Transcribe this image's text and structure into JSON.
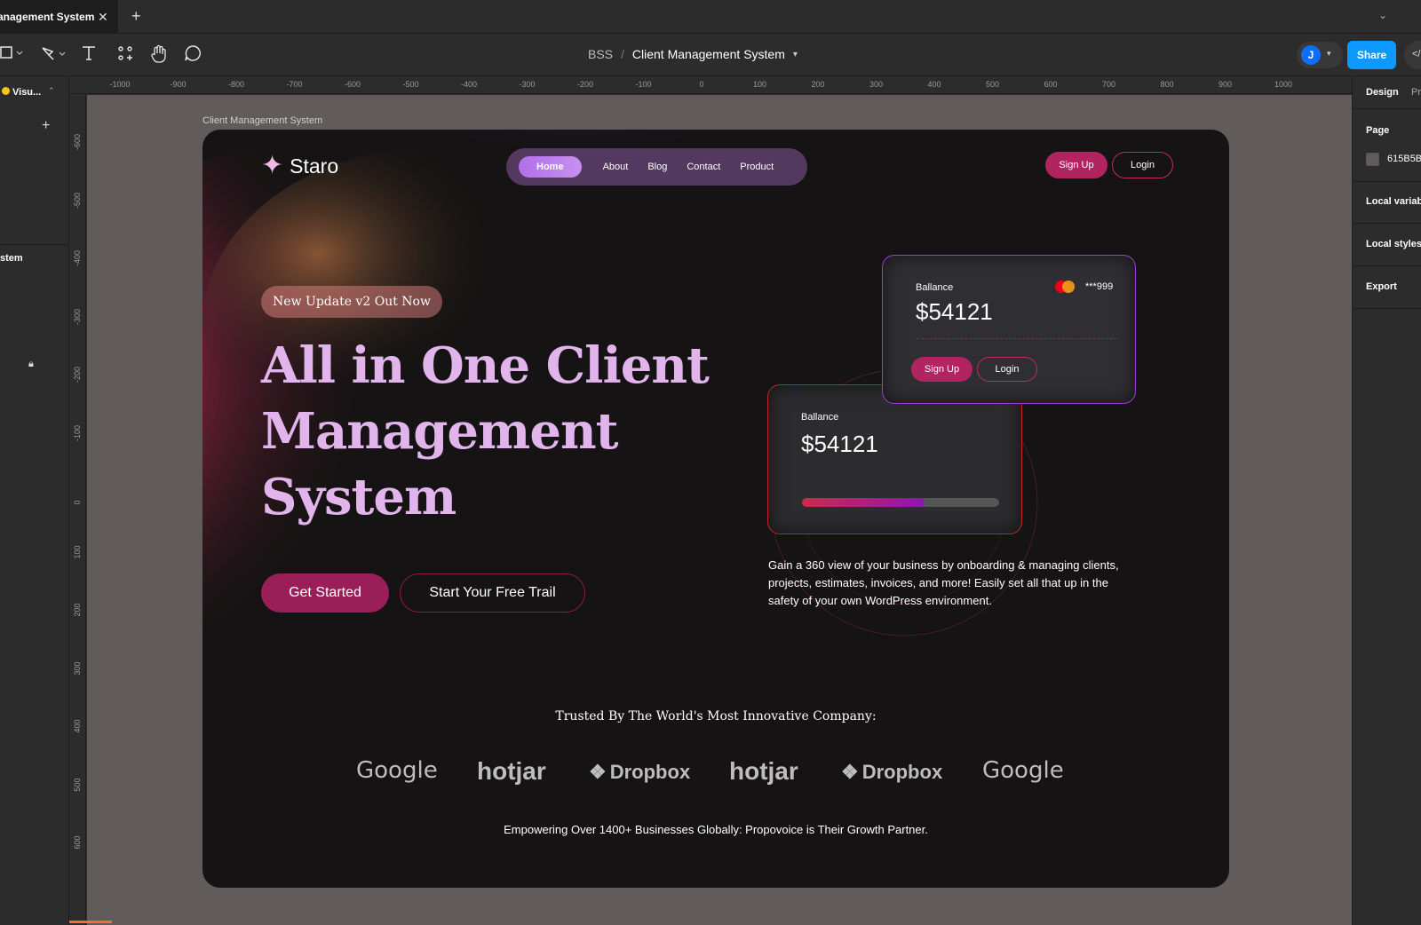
{
  "app": {
    "tab_title": "anagement System",
    "project": "BSS",
    "file_name": "Client Management System",
    "user_initial": "J",
    "share_label": "Share",
    "code_label": "</"
  },
  "left_panel": {
    "page_name": "Visu...",
    "layer_name": "stem"
  },
  "rulers": {
    "top": [
      "-1000",
      "-900",
      "-800",
      "-700",
      "-600",
      "-500",
      "-400",
      "-300",
      "-200",
      "-100",
      "0",
      "100",
      "200",
      "300",
      "400",
      "500",
      "600",
      "700",
      "800",
      "900",
      "1000"
    ],
    "left": [
      "-600",
      "-500",
      "-400",
      "-300",
      "-200",
      "-100",
      "0",
      "100",
      "200",
      "300",
      "400",
      "500",
      "600"
    ]
  },
  "canvas": {
    "frame_label": "Client Management System",
    "background_color": "#615B5B"
  },
  "site": {
    "brand": "Staro",
    "nav": [
      "Home",
      "About",
      "Blog",
      "Contact",
      "Product"
    ],
    "signup": "Sign Up",
    "login": "Login",
    "badge": "New Update v2 Out Now",
    "hero_lines": [
      "All in One Client",
      "Management",
      "System"
    ],
    "cta_primary": "Get Started",
    "cta_secondary": "Start Your Free Trail",
    "card_front": {
      "label": "Ballance",
      "amount": "$54121",
      "card_number": "***999",
      "signup": "Sign Up",
      "login": "Login"
    },
    "card_back": {
      "label": "Ballance",
      "amount": "$54121",
      "progress": 0.62
    },
    "description": "Gain a 360 view of your business by onboarding & managing clients, projects, estimates, invoices, and more! Easily set all that up in the safety of your own WordPress environment.",
    "trusted_title": "Trusted By The  World's Most Innovative Company:",
    "logos": [
      "Google",
      "hotjar",
      "Dropbox",
      "hotjar",
      "Dropbox",
      "Google"
    ],
    "footer": "Empowering Over 1400+ Businesses Globally: Propovoice is Their Growth Partner.",
    "colors": {
      "accent": "#B2245F",
      "hero_text": "#E2B4EC",
      "frame_bg": "#151313"
    }
  },
  "right_panel": {
    "tab_design": "Design",
    "tab_prototype": "Pro",
    "page_heading": "Page",
    "page_color": "615B5B",
    "local_variables": "Local variabl",
    "local_styles": "Local styles",
    "export": "Export"
  }
}
